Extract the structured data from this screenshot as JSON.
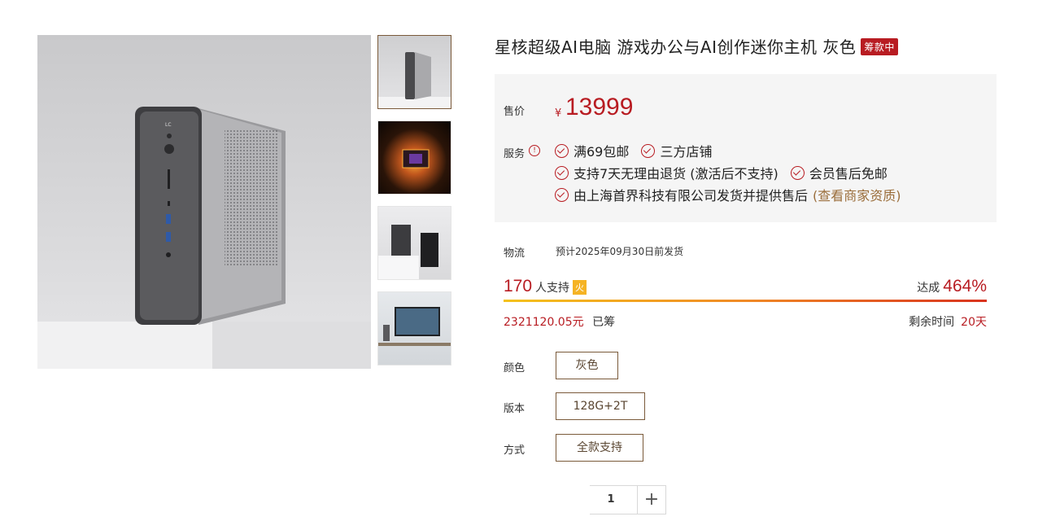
{
  "gallery": {
    "main_image": "mini-pc-gray-front",
    "thumbnails": [
      "mini-pc-gray-front",
      "processor-chip-glow",
      "two-mini-pcs-silver-black",
      "mini-pc-desk-tv-setup"
    ],
    "active_index": 0
  },
  "product": {
    "title": "星核超级AI电脑 游戏办公与AI创作迷你主机 灰色",
    "status_badge": "筹款中"
  },
  "price": {
    "label": "售价",
    "currency": "¥",
    "value": "13999"
  },
  "services": {
    "label": "服务",
    "alert_icon": "!",
    "row1": [
      "满69包邮",
      "三方店铺"
    ],
    "row2": [
      "支持7天无理由退货 (激活后不支持)",
      "会员售后免邮"
    ],
    "row3_text": "由上海首界科技有限公司发货并提供售后",
    "row3_link": "(查看商家资质)"
  },
  "shipping": {
    "label": "物流",
    "value": "预计2025年09月30日前发货"
  },
  "crowdfunding": {
    "supporters": "170",
    "supporters_label": "人支持",
    "hot_icon": "火",
    "reached_label": "达成",
    "reached_percent": "464%",
    "progress_fraction": 1.0,
    "raised_amount": "2321120.05元",
    "raised_label": "已筹",
    "remaining_label": "剩余时间",
    "remaining_value": "20天"
  },
  "options": {
    "color_label": "颜色",
    "color_value": "灰色",
    "version_label": "版本",
    "version_value": "128G+2T",
    "payment_label": "方式",
    "payment_value": "全款支持"
  },
  "quantity": {
    "minus": "−",
    "value": "1",
    "plus": "+"
  },
  "colors": {
    "accent": "#b81c22",
    "brown": "#7a5a3a",
    "bar_start": "#f4c21d",
    "bar_end": "#d9331e"
  }
}
